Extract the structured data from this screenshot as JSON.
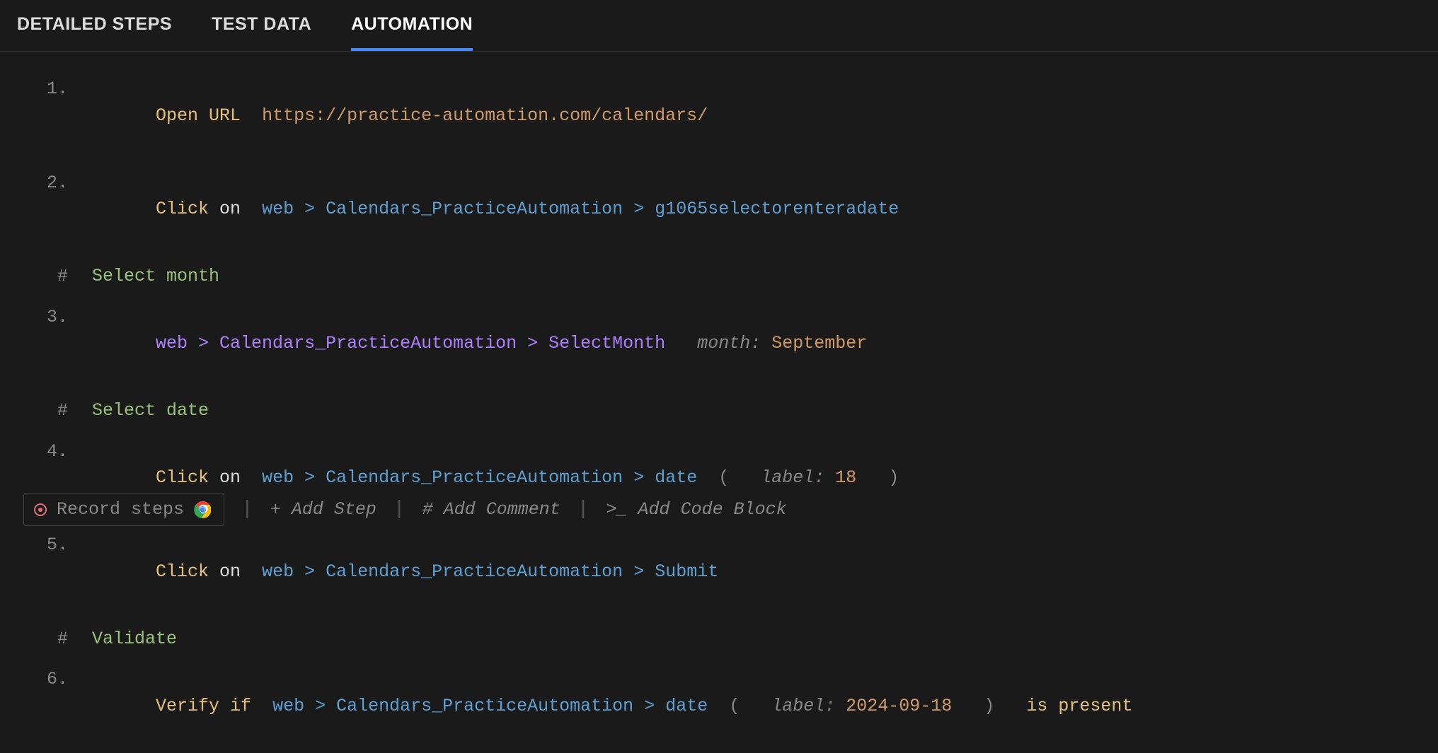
{
  "tabs": {
    "detailed_steps": "DETAILED STEPS",
    "test_data": "TEST DATA",
    "automation": "AUTOMATION"
  },
  "lines": {
    "l1": {
      "num": "1.",
      "action": "Open URL",
      "url": "https://practice-automation.com/calendars/"
    },
    "l2": {
      "num": "2.",
      "action": "Click",
      "on": "on",
      "webkw": "web",
      "sep1": " > ",
      "page": "Calendars_PracticeAutomation",
      "sep2": " > ",
      "elem": "g1065selectorenteradate"
    },
    "c1": {
      "hash": "#",
      "text": "Select month"
    },
    "l3": {
      "num": "3.",
      "webkw": "web",
      "sep1": " > ",
      "page": "Calendars_PracticeAutomation",
      "sep2": " > ",
      "elem": "SelectMonth",
      "paramk": "month:",
      "paramv": "September"
    },
    "c2": {
      "hash": "#",
      "text": "Select date"
    },
    "l4": {
      "num": "4.",
      "action": "Click",
      "on": "on",
      "webkw": "web",
      "sep1": " > ",
      "page": "Calendars_PracticeAutomation",
      "sep2": " > ",
      "elem": "date",
      "lp": "(",
      "paramk": "label:",
      "paramv": "18",
      "rp": ")"
    },
    "l5": {
      "num": "5.",
      "action": "Click",
      "on": "on",
      "webkw": "web",
      "sep1": " > ",
      "page": "Calendars_PracticeAutomation",
      "sep2": " > ",
      "elem": "Submit"
    },
    "c3": {
      "hash": "#",
      "text": "Validate"
    },
    "l6": {
      "num": "6.",
      "action": "Verify if",
      "webkw": "web",
      "sep1": " > ",
      "page": "Calendars_PracticeAutomation",
      "sep2": " > ",
      "elem": "date",
      "lp": "(",
      "paramk": "label:",
      "paramv": "2024-09-18",
      "rp": ")",
      "suffix": "is present"
    }
  },
  "footer": {
    "record": "Record steps",
    "add_step": "+ Add Step",
    "add_comment": "# Add Comment",
    "add_code": ">_ Add Code Block"
  }
}
